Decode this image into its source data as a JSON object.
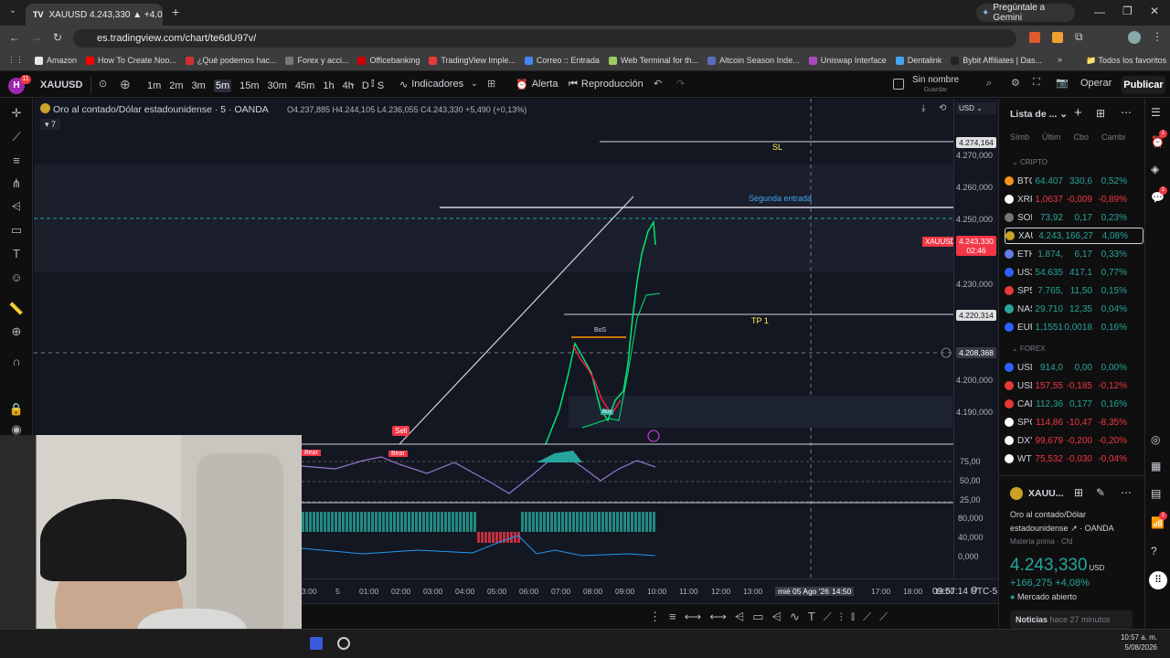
{
  "browser": {
    "tab_title": "XAUUSD 4.243,330 ▲ +4.08% S",
    "gemini_button": "Pregúntale a Gemini",
    "url": "es.tradingview.com/chart/te6dU97v/",
    "bookmarks": [
      "Amazon",
      "How To Create Noo...",
      "¿Qué podemos hac...",
      "Forex y acci...",
      "Officebanking",
      "TradingView Imple...",
      "Correo :: Entrada",
      "Web Terminal for th...",
      "Altcoin Season Inde...",
      "Uniswap Interface",
      "Dentalink",
      "Bybit Affiliates | Das..."
    ],
    "all_bookmarks": "Todos los favoritos",
    "bookmark_colors": [
      "#e8e8e8",
      "#ff0000",
      "#d32f2f",
      "#777777",
      "#cc0000",
      "#e53935",
      "#4285f4",
      "#9ccc65",
      "#5c6bc0",
      "#ab47bc",
      "#42a5f5",
      "#222222"
    ]
  },
  "toolbar": {
    "avatar_badge": "11",
    "symbol": "XAUUSD",
    "timeframes": [
      "1m",
      "2m",
      "3m",
      "5m",
      "15m",
      "30m",
      "45m",
      "1h",
      "4h",
      "D",
      "S"
    ],
    "active_timeframe": "5m",
    "indicators": "Indicadores",
    "alert": "Alerta",
    "replay": "Reproducción",
    "layout_name": "Sin nombre",
    "save_label": "Guardar",
    "trade": "Operar",
    "publish": "Publicar"
  },
  "chart": {
    "title": "Oro al contado/Dólar estadounidense · 5 · OANDA",
    "ohlc": "O4.237,885 H4.244,105 L4.236,055 C4.243,330 +5,490 (+0,13%)",
    "indicator_count": "7",
    "currency": "USD",
    "labels": {
      "sl": "SL",
      "second_entry": "Segunda entrada",
      "tp1": "TP 1",
      "bos": "BoS",
      "sell": "Sell",
      "bear": "Bear",
      "buy": "Buy"
    },
    "price_ticks": [
      "4.270,000",
      "4.260,000",
      "4.250,000",
      "4.230,000",
      "4.200,000",
      "4.190,000"
    ],
    "price_boxes": [
      {
        "text": "4.274,164",
        "color": "#d1d4dc",
        "bg": "#e0e0e0"
      },
      {
        "text": "4.243,330",
        "color": "#ffffff",
        "bg": "#f23645"
      },
      {
        "text": "02:46",
        "color": "#ffffff",
        "bg": "#f23645"
      },
      {
        "text": "4.220,314",
        "color": "#131722",
        "bg": "#e0e0e0"
      },
      {
        "text": "4.208,368",
        "color": "#ffffff",
        "bg": "#363a45"
      }
    ],
    "symbol_tag": "XAUUSD",
    "osc1_ticks": [
      "75,00",
      "50,00",
      "25,00"
    ],
    "osc2_ticks": [
      "80,000",
      "40,000",
      "0,000"
    ],
    "time_ticks": [
      "3:00",
      "5",
      "01:00",
      "02:00",
      "03:00",
      "04:00",
      "05:00",
      "06:00",
      "07:00",
      "08:00",
      "09:00",
      "10:00",
      "11:00",
      "12:00",
      "13:00",
      "mié 05 Ago '26",
      "14:50",
      "17:00",
      "18:00",
      "19:00"
    ],
    "clock": "09:57:14 UTC-5"
  },
  "watchlist": {
    "title": "Lista de ...",
    "columns": [
      "Símb",
      "Últim",
      "Cbo",
      "Cambi"
    ],
    "section_crypto": "CRIPTO",
    "section_forex": "FOREX",
    "crypto": [
      {
        "s": "BTC",
        "l": "64.407",
        "c": "330,6",
        "p": "0,52%",
        "dir": "up",
        "color": "#f7931a"
      },
      {
        "s": "XRP",
        "l": "1,0637",
        "c": "-0,009",
        "p": "-0,89%",
        "dir": "dn",
        "color": "#ffffff"
      },
      {
        "s": "SOL",
        "l": "73,92",
        "c": "0,17",
        "p": "0,23%",
        "dir": "up",
        "color": "#777777"
      },
      {
        "s": "XAU",
        "l": "4.243,",
        "c": "166,27",
        "p": "4,08%",
        "dir": "up",
        "color": "#c9a227"
      },
      {
        "s": "ETH",
        "l": "1.874,",
        "c": "6,17",
        "p": "0,33%",
        "dir": "up",
        "color": "#627eea"
      },
      {
        "s": "US3",
        "l": "54.635",
        "c": "417,1",
        "p": "0,77%",
        "dir": "up",
        "color": "#2962ff"
      },
      {
        "s": "SP5",
        "l": "7.765,",
        "c": "11,50",
        "p": "0,15%",
        "dir": "up",
        "color": "#e53935"
      },
      {
        "s": "NAS",
        "l": "29.710",
        "c": "12,35",
        "p": "0,04%",
        "dir": "up",
        "color": "#26a69a"
      },
      {
        "s": "EUR",
        "l": "1,1551",
        "c": "0,0018",
        "p": "0,16%",
        "dir": "up",
        "color": "#2962ff"
      }
    ],
    "forex": [
      {
        "s": "USD",
        "l": "914,0",
        "c": "0,00",
        "p": "0,00%",
        "dir": "up",
        "color": "#2962ff"
      },
      {
        "s": "USD",
        "l": "157,55",
        "c": "-0,185",
        "p": "-0,12%",
        "dir": "dn",
        "color": "#e53935"
      },
      {
        "s": "CAD",
        "l": "112,36",
        "c": "0,177",
        "p": "0,16%",
        "dir": "up",
        "color": "#e53935"
      },
      {
        "s": "SPC",
        "l": "114,86",
        "c": "-10,47",
        "p": "-8,35%",
        "dir": "dn",
        "color": "#ffffff"
      },
      {
        "s": "DXY",
        "l": "99,679",
        "c": "-0,200",
        "p": "-0,20%",
        "dir": "dn",
        "color": "#ffffff"
      },
      {
        "s": "WT",
        "l": "75,532",
        "c": "-0,030",
        "p": "-0,04%",
        "dir": "dn",
        "color": "#ffffff"
      }
    ]
  },
  "details": {
    "symbol": "XAUU...",
    "name": "Oro al contado/Dólar",
    "name2": "estadounidense",
    "exchange": "OANDA",
    "category": "Materia prima · Cfd",
    "price": "4.243,330",
    "currency": "USD",
    "change": "+166,275  +4,08%",
    "market_status": "Mercado abierto",
    "news_label": "Noticias",
    "news_time": "hace 27 minutos"
  },
  "right_icon_badges": [
    "1",
    "1",
    "1"
  ],
  "taskbar": {
    "time": "10:57 a. m.",
    "date": "5/08/2026"
  }
}
